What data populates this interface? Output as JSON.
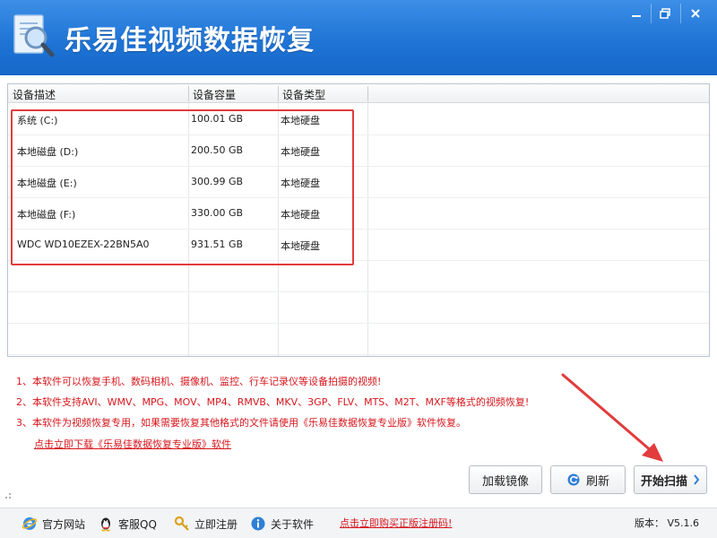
{
  "window": {
    "title": "乐易佳视频数据恢复"
  },
  "columns": [
    "设备描述",
    "设备容量",
    "设备类型"
  ],
  "devices": [
    {
      "name": "系统 (C:)",
      "size": "100.01 GB",
      "type": "本地硬盘"
    },
    {
      "name": "本地磁盘 (D:)",
      "size": "200.50 GB",
      "type": "本地硬盘"
    },
    {
      "name": "本地磁盘 (E:)",
      "size": "300.99 GB",
      "type": "本地硬盘"
    },
    {
      "name": "本地磁盘 (F:)",
      "size": "330.00 GB",
      "type": "本地硬盘"
    },
    {
      "name": "WDC WD10EZEX-22BN5A0",
      "size": "931.51 GB",
      "type": "本地硬盘"
    }
  ],
  "notes": [
    "1、本软件可以恢复手机、数码相机、摄像机、监控、行车记录仪等设备拍摄的视频!",
    "2、本软件支持AVI、WMV、MPG、MOV、MP4、RMVB、MKV、3GP、FLV、MTS、M2T、MXF等格式的视频恢复!",
    "3、本软件为视频恢复专用，如果需要恢复其他格式的文件请使用《乐易佳数据恢复专业版》软件恢复。"
  ],
  "download_link": "点击立即下载《乐易佳数据恢复专业版》软件",
  "buttons": {
    "mount_image": "加载镜像",
    "refresh": "刷新",
    "start_scan": "开始扫描"
  },
  "bottom": {
    "website": "官方网站",
    "support_qq": "客服QQ",
    "register": "立即注册",
    "about": "关于软件",
    "buy_link": "点击立即购买正版注册码!",
    "version": "版本： V5.1.6"
  },
  "colors": {
    "title_bar": "#1f74d6",
    "highlight": "#e23c3c",
    "note_text": "#d6161c"
  }
}
